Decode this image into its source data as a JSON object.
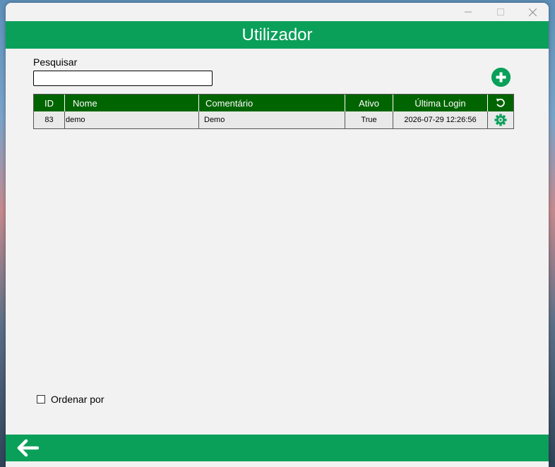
{
  "window": {
    "title": "Utilizador"
  },
  "search": {
    "label": "Pesquisar",
    "value": "",
    "placeholder": ""
  },
  "table": {
    "columns": [
      "ID",
      "Nome",
      "Comentário",
      "Ativo",
      "Última Login"
    ],
    "rows": [
      {
        "id": "83",
        "nome": "demo",
        "comentario": "Demo",
        "ativo": "True",
        "ultima_login": "2026-07-29 12:26:56"
      }
    ]
  },
  "sort": {
    "label": "Ordenar por",
    "checked": false
  },
  "icons": {
    "add": "plus-circle-icon",
    "refresh": "refresh-icon",
    "settings": "gear-icon",
    "back": "arrow-left-icon"
  },
  "colors": {
    "accent": "#0aa05a",
    "table_header": "#006400"
  }
}
